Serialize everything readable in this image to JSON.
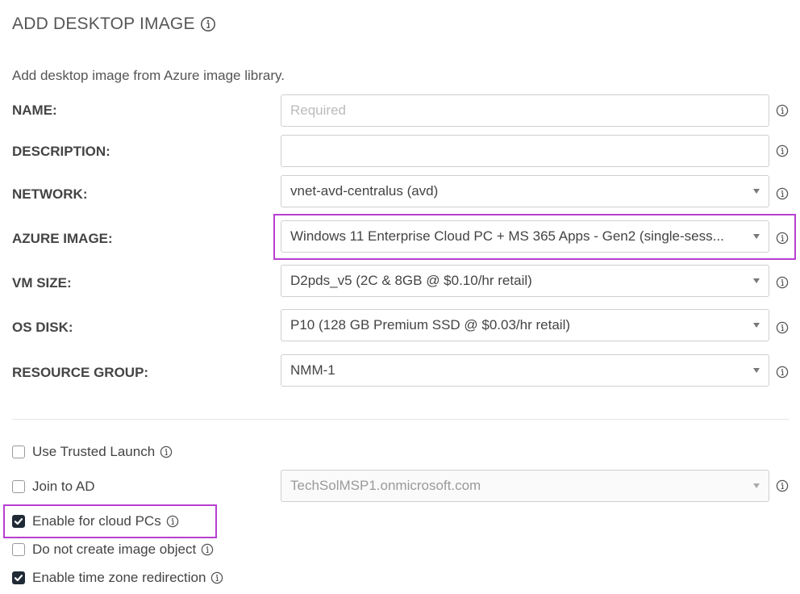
{
  "header": {
    "title": "ADD DESKTOP IMAGE",
    "subtitle": "Add desktop image from Azure image library."
  },
  "form": {
    "name": {
      "label": "NAME:",
      "placeholder": "Required",
      "value": ""
    },
    "description": {
      "label": "DESCRIPTION:",
      "value": ""
    },
    "network": {
      "label": "NETWORK:",
      "value": "vnet-avd-centralus (avd)"
    },
    "azure_image": {
      "label": "AZURE IMAGE:",
      "value": "Windows 11 Enterprise Cloud PC + MS 365 Apps - Gen2 (single-sess..."
    },
    "vm_size": {
      "label": "VM SIZE:",
      "value": "D2pds_v5 (2C & 8GB @ $0.10/hr retail)"
    },
    "os_disk": {
      "label": "OS DISK:",
      "value": "P10 (128 GB Premium SSD @ $0.03/hr retail)"
    },
    "resource_group": {
      "label": "RESOURCE GROUP:",
      "value": "NMM-1"
    }
  },
  "options": {
    "trusted_launch": {
      "label": "Use Trusted Launch",
      "checked": false
    },
    "join_ad": {
      "label": "Join to AD",
      "checked": false,
      "domain": "TechSolMSP1.onmicrosoft.com"
    },
    "cloud_pcs": {
      "label": "Enable for cloud PCs",
      "checked": true
    },
    "no_image_object": {
      "label": "Do not create image object",
      "checked": false
    },
    "tz_redirection": {
      "label": "Enable time zone redirection",
      "checked": true
    }
  },
  "colors": {
    "highlight": "#b83fd0",
    "checkbox_checked": "#1f2a36"
  },
  "icons": {
    "info": "info-circle-icon",
    "dropdown": "caret-down-icon",
    "check": "checkmark-icon"
  }
}
